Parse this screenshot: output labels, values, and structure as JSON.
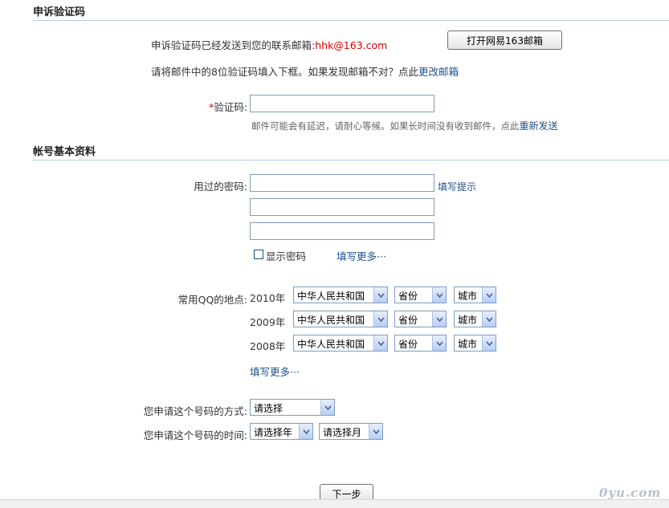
{
  "section1": {
    "title": "申诉验证码",
    "sent_text": "申诉验证码已经发送到您的联系邮箱:",
    "email": "hhk@163.com",
    "open_mail_button": "打开网易163邮箱",
    "instruction": "请将邮件中的8位验证码填入下框。如果发现邮箱不对？点此",
    "change_email_link": "更改邮箱",
    "code_required_mark": "*",
    "code_label": "验证码:",
    "code_value": "",
    "delay_hint": "邮件可能会有延迟，请耐心等候。如果长时间没有收到邮件，点此",
    "resend_link": "重新发送"
  },
  "section2": {
    "title": "帐号基本资料",
    "password_label": "用过的密码:",
    "password_hint_link": "填写提示",
    "passwords": [
      "",
      "",
      ""
    ],
    "show_password_label": "显示密码",
    "fill_more_link": "填写更多···",
    "location_label": "常用QQ的地点:",
    "locations": [
      {
        "year": "2010年",
        "country": "中华人民共和国",
        "province": "省份",
        "city": "城市"
      },
      {
        "year": "2009年",
        "country": "中华人民共和国",
        "province": "省份",
        "city": "城市"
      },
      {
        "year": "2008年",
        "country": "中华人民共和国",
        "province": "省份",
        "city": "城市"
      }
    ],
    "location_more_link": "填写更多···",
    "apply_method_label": "您申请这个号码的方式:",
    "apply_method_value": "请选择",
    "apply_time_label": "您申请这个号码的时间:",
    "apply_year_value": "请选择年",
    "apply_month_value": "请选择月"
  },
  "next_button": "下一步",
  "watermark": "0yu.com"
}
